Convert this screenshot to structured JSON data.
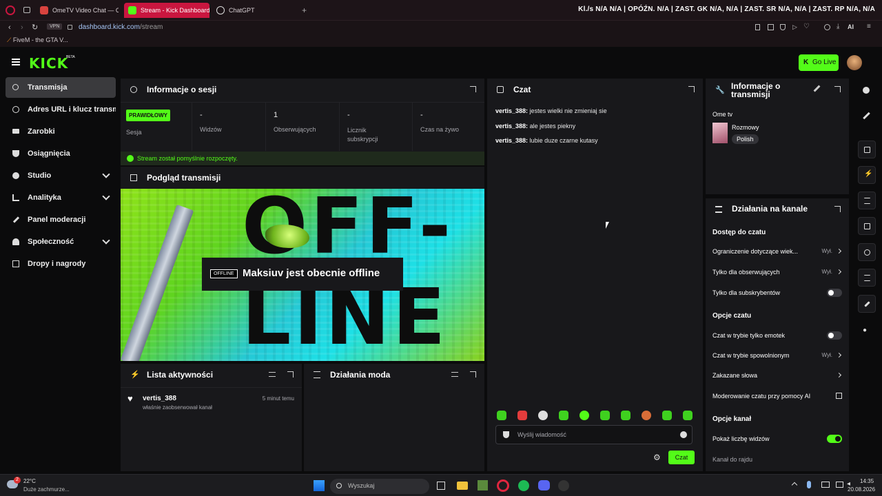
{
  "browser": {
    "tabs": [
      {
        "label": "OmeTV Video Chat — C",
        "active": false
      },
      {
        "label": "Stream - Kick Dashboard",
        "active": true
      },
      {
        "label": "ChatGPT",
        "active": false
      }
    ],
    "stats": "Kl./s  N/A  N/A  |  OPÓŹN.  N/A  |  ZAST. GK  N/A, N/A  |  ZAST. SR  N/A, N/A  |  ZAST. RP  N/A, N/A",
    "vpn_label": "VPN",
    "url_host": "dashboard.kick.com",
    "url_path": "/stream",
    "ai_label": "AI",
    "bookmark": "FiveM - the GTA V..."
  },
  "header": {
    "logo": "KICK",
    "logo_badge": "BETA",
    "go_live": "Go Live"
  },
  "sidebar": {
    "items": [
      {
        "label": "Transmisja",
        "icon": "broadcast-icon",
        "active": true
      },
      {
        "label": "Adres URL i klucz transmisji",
        "icon": "link-icon"
      },
      {
        "label": "Zarobki",
        "icon": "money-icon"
      },
      {
        "label": "Osiągnięcia",
        "icon": "trophy-icon"
      },
      {
        "label": "Studio",
        "icon": "studio-icon",
        "expandable": true
      },
      {
        "label": "Analityka",
        "icon": "chart-icon",
        "expandable": true
      },
      {
        "label": "Panel moderacji",
        "icon": "wrench-icon"
      },
      {
        "label": "Społeczność",
        "icon": "people-icon",
        "expandable": true
      },
      {
        "label": "Dropy i nagrody",
        "icon": "gift-icon"
      }
    ]
  },
  "session": {
    "title": "Informacje o sesji",
    "badge": "PRAWIDŁOWY",
    "session_label": "Sesja",
    "stats": [
      {
        "value": "-",
        "label": "Widzów"
      },
      {
        "value": "1",
        "label": "Obserwujących"
      },
      {
        "value": "-",
        "label": "Licznik subskrypcji"
      },
      {
        "value": "-",
        "label": "Czas na żywo"
      }
    ],
    "status": "Stream został pomyślnie rozpoczęty."
  },
  "preview": {
    "title": "Podgląd transmisji",
    "offline_tag": "OFFLINE",
    "offline_text": "Maksiuv jest obecnie offline",
    "bg_word_top": "OFF-",
    "bg_word_bottom": "LINE"
  },
  "activity": {
    "title": "Lista aktywności",
    "items": [
      {
        "user": "vertis_388",
        "text": "właśnie zaobserwował kanał",
        "time": "5 minut temu"
      }
    ]
  },
  "mod_actions": {
    "title": "Działania moda"
  },
  "chat": {
    "title": "Czat",
    "messages": [
      {
        "user": "vertis_388:",
        "text": "jestes wielki nie zmieniaj sie"
      },
      {
        "user": "vertis_388:",
        "text": "ale jestes piekny"
      },
      {
        "user": "vertis_388:",
        "text": "lubie duze czarne kutasy"
      }
    ],
    "placeholder": "Wyślij wiadomość",
    "send": "Czat"
  },
  "stream_info": {
    "title": "Informacje o transmisji",
    "title_line1": "Informacje o",
    "title_line2": "transmisji",
    "stream_title": "Ome tv",
    "category": "Rozmowy",
    "tag": "Polish"
  },
  "channel_actions": {
    "title": "Działania na kanale",
    "sections": [
      {
        "heading": "Dostęp do czatu"
      },
      {
        "heading": "Opcje czatu"
      },
      {
        "heading": "Opcje kanał"
      }
    ],
    "rows": {
      "age": {
        "label": "Ograniczenie dotyczące wiek...",
        "value": "Wył."
      },
      "followers": {
        "label": "Tylko dla obserwujących",
        "value": "Wył."
      },
      "subs": {
        "label": "Tylko dla subskrybentów",
        "toggle": false
      },
      "emotes": {
        "label": "Czat w trybie tylko emotek",
        "toggle": false
      },
      "slow": {
        "label": "Czat w trybie spowolnionym",
        "value": "Wył."
      },
      "banned": {
        "label": "Zakazane słowa"
      },
      "ai": {
        "label": "Moderowanie czatu przy pomocy AI"
      },
      "viewers": {
        "label": "Pokaż liczbę widzów",
        "toggle": true
      },
      "raid": {
        "label": "Kanał do rajdu"
      }
    }
  },
  "taskbar": {
    "weather_temp": "22°C",
    "weather_desc": "Duże zachmurze...",
    "weather_badge": "2",
    "search": "Wyszukaj",
    "time": "14:35",
    "date": "20.08.2026"
  },
  "colors": {
    "accent": "#53fc18",
    "panel": "#18181b",
    "tab_active": "#c9163f"
  }
}
